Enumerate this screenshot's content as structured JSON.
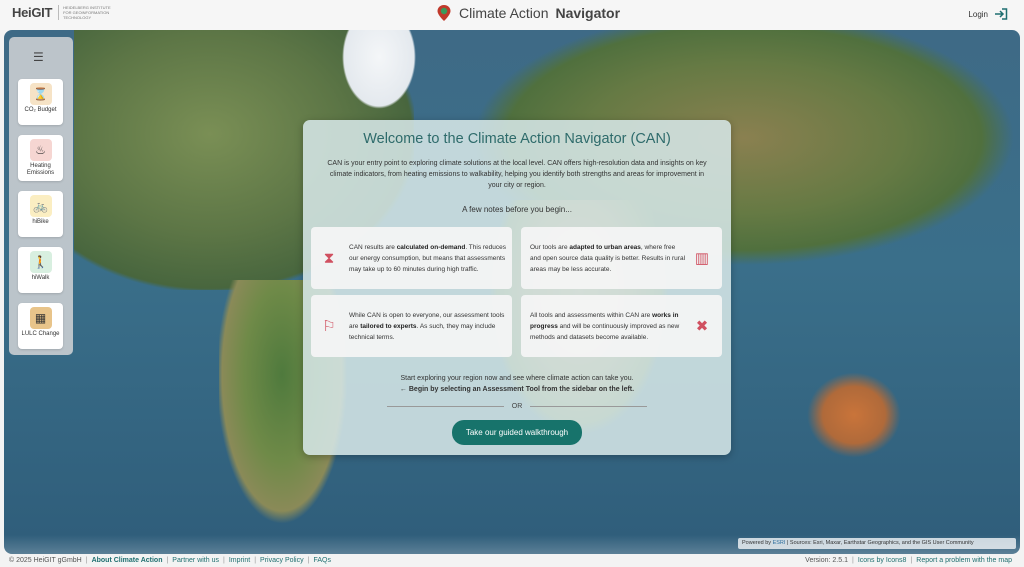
{
  "header": {
    "logo_text": "HeiGIT",
    "logo_subtitle": "Heidelberg Institute for Geoinformation Technology",
    "app_title_main": "Climate Action",
    "app_title_strong": "Navigator",
    "login_label": "Login"
  },
  "sidebar": {
    "tools": [
      {
        "label": "CO₂ Budget",
        "icon": "hourglass-icon",
        "color": "#e8a13a"
      },
      {
        "label": "Heating Emissions",
        "icon": "radiator-icon",
        "color": "#c0392b"
      },
      {
        "label": "hiBike",
        "icon": "bike-icon",
        "color": "#f0b400"
      },
      {
        "label": "hiWalk",
        "icon": "walking-icon",
        "color": "#2e8b57"
      },
      {
        "label": "LULC Change",
        "icon": "land-cover-icon",
        "color": "#d35400"
      }
    ]
  },
  "welcome": {
    "title": "Welcome to the Climate Action Navigator (CAN)",
    "intro": "CAN is your entry point to exploring climate solutions at the local level. CAN offers high-resolution data and insights on key climate indicators, from heating emissions to walkability, helping you identify both strengths and areas for improvement in your city or region.",
    "notes_heading": "A few notes before you begin...",
    "cards": [
      {
        "pre": "CAN results are ",
        "bold": "calculated on-demand",
        "post": ". This reduces our energy consumption, but means that assessments may take up to 60 minutes during high traffic.",
        "icon": "hourglass-icon"
      },
      {
        "pre": "Our tools are ",
        "bold": "adapted to urban areas",
        "post": ", where free and open source data quality is better. Results in rural areas may be less accurate.",
        "icon": "buildings-icon"
      },
      {
        "pre": "While CAN is open to everyone, our assessment tools are ",
        "bold": "tailored to experts",
        "post": ". As such, they may include technical terms.",
        "icon": "teacher-icon"
      },
      {
        "pre": "All tools and assessments within CAN are ",
        "bold": "works in progress",
        "post": " and will be continuously improved as new methods and datasets become available.",
        "icon": "tools-icon"
      }
    ],
    "explore_text": "Start exploring your region now and see where climate action can take you.",
    "explore_hint": "← Begin by selecting an Assessment Tool from the sidebar on the left.",
    "or_label": "OR",
    "walkthrough_button": "Take our guided walkthrough"
  },
  "attribution": {
    "powered": "Powered by ",
    "esri": "ESRI",
    "sources": " | Sources: Esri, Maxar, Earthstar Geographics, and the GIS User Community"
  },
  "footer": {
    "copyright": "© 2025 HeiGIT gGmbH",
    "links": [
      "About Climate Action",
      "Partner with us",
      "Imprint",
      "Privacy Policy",
      "FAQs"
    ],
    "version": "Version: 2.5.1",
    "icons_credit": "Icons by Icons8",
    "report_link": "Report a problem with the map"
  }
}
